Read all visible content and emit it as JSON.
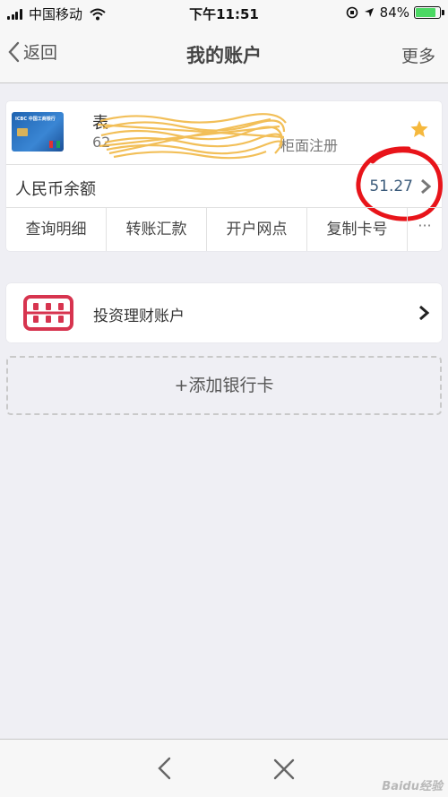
{
  "status_bar": {
    "carrier": "中国移动",
    "time": "下午11:51",
    "battery": "84%",
    "battery_level": 0.84,
    "battery_color": "#4cd964"
  },
  "nav": {
    "back": "返回",
    "title": "我的账户",
    "more": "更多"
  },
  "account_card": {
    "card_image_text": "ICBC 中国工商银行",
    "name_partial": "表",
    "number_partial": "62",
    "status": "柜面注册",
    "star_color": "#f5b83d",
    "balance_label": "人民币余额",
    "balance_value": "51.27",
    "actions": [
      "查询明细",
      "转账汇款",
      "开户网点",
      "复制卡号"
    ],
    "more_actions": "···",
    "annotation_color": "#e8141a"
  },
  "invest": {
    "label": "投资理财账户",
    "icon_color": "#d7344f"
  },
  "add_card": {
    "label": "+添加银行卡"
  },
  "watermark": "Baidu经验"
}
